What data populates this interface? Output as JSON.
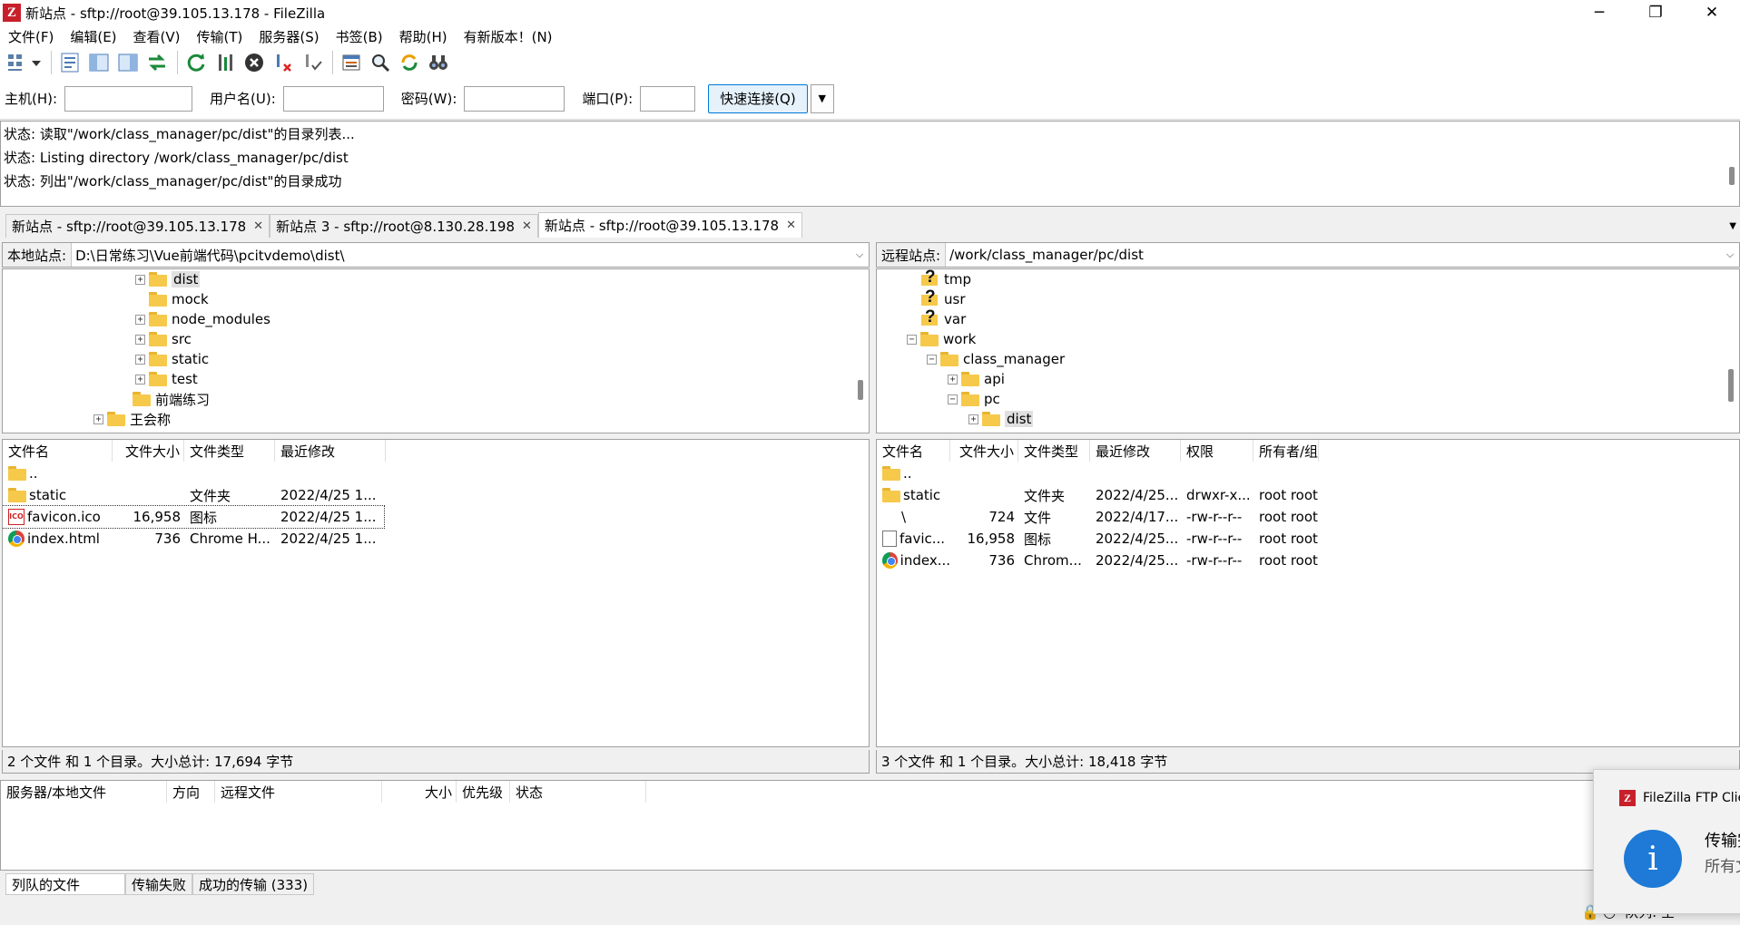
{
  "window": {
    "title": "新站点 - sftp://root@39.105.13.178 - FileZilla",
    "controls": [
      "─",
      "❐",
      "✕"
    ]
  },
  "menu": [
    "文件(F)",
    "编辑(E)",
    "查看(V)",
    "传输(T)",
    "服务器(S)",
    "书签(B)",
    "帮助(H)",
    "有新版本！(N)"
  ],
  "quickconnect": {
    "host_label": "主机(H):",
    "user_label": "用户名(U):",
    "pass_label": "密码(W):",
    "port_label": "端口(P):",
    "host_value": "",
    "user_value": "",
    "pass_value": "",
    "port_value": "",
    "connect_label": "快速连接(Q)"
  },
  "log": [
    "状态:  读取\"/work/class_manager/pc/dist\"的目录列表...",
    "状态:  Listing directory /work/class_manager/pc/dist",
    "状态:  列出\"/work/class_manager/pc/dist\"的目录成功"
  ],
  "tabs": [
    {
      "label": "新站点 - sftp://root@39.105.13.178"
    },
    {
      "label": "新站点 3 - sftp://root@8.130.28.198"
    },
    {
      "label": "新站点 - sftp://root@39.105.13.178"
    }
  ],
  "local": {
    "site_label": "本地站点:",
    "path": "D:\\日常练习\\Vue前端代码\\pcitvdemo\\dist\\",
    "tree": [
      {
        "name": "dist",
        "expander": "+"
      },
      {
        "name": "mock",
        "expander": ""
      },
      {
        "name": "node_modules",
        "expander": "+"
      },
      {
        "name": "src",
        "expander": "+"
      },
      {
        "name": "static",
        "expander": "+"
      },
      {
        "name": "test",
        "expander": "+"
      },
      {
        "name": "前端练习",
        "expander": ""
      },
      {
        "name": "王会称",
        "expander": "+"
      }
    ],
    "columns": [
      "文件名",
      "文件大小",
      "文件类型",
      "最近修改"
    ],
    "files": [
      {
        "name": "..",
        "size": "",
        "type": "",
        "modified": ""
      },
      {
        "name": "static",
        "size": "",
        "type": "文件夹",
        "modified": "2022/4/25 1..."
      },
      {
        "name": "favicon.ico",
        "size": "16,958",
        "type": "图标",
        "modified": "2022/4/25 1..."
      },
      {
        "name": "index.html",
        "size": "736",
        "type": "Chrome H...",
        "modified": "2022/4/25 1..."
      }
    ],
    "status": "2 个文件 和 1 个目录。大小总计: 17,694 字节"
  },
  "remote": {
    "site_label": "远程站点:",
    "path": "/work/class_manager/pc/dist",
    "tree": [
      {
        "name": "tmp",
        "expander": "",
        "icon": "unknown"
      },
      {
        "name": "usr",
        "expander": "",
        "icon": "unknown"
      },
      {
        "name": "var",
        "expander": "",
        "icon": "unknown"
      },
      {
        "name": "work",
        "expander": "−",
        "icon": "folder"
      },
      {
        "name": "class_manager",
        "expander": "−",
        "icon": "folder"
      },
      {
        "name": "api",
        "expander": "+",
        "icon": "folder"
      },
      {
        "name": "pc",
        "expander": "−",
        "icon": "folder"
      },
      {
        "name": "dist",
        "expander": "+",
        "icon": "folder"
      }
    ],
    "columns": [
      "文件名",
      "文件大小",
      "文件类型",
      "最近修改",
      "权限",
      "所有者/组"
    ],
    "files": [
      {
        "name": "..",
        "size": "",
        "type": "",
        "modified": "",
        "perms": "",
        "owner": ""
      },
      {
        "name": "static",
        "size": "",
        "type": "文件夹",
        "modified": "2022/4/25...",
        "perms": "drwxr-x...",
        "owner": "root root"
      },
      {
        "name": "\\",
        "size": "724",
        "type": "文件",
        "modified": "2022/4/17...",
        "perms": "-rw-r--r--",
        "owner": "root root"
      },
      {
        "name": "favic...",
        "size": "16,958",
        "type": "图标",
        "modified": "2022/4/25...",
        "perms": "-rw-r--r--",
        "owner": "root root"
      },
      {
        "name": "index...",
        "size": "736",
        "type": "Chrom...",
        "modified": "2022/4/25...",
        "perms": "-rw-r--r--",
        "owner": "root root"
      }
    ],
    "status": "3 个文件 和 1 个目录。大小总计: 18,418 字节"
  },
  "queue": {
    "columns": [
      "服务器/本地文件",
      "方向",
      "远程文件",
      "大小",
      "优先级",
      "状态"
    ],
    "tabs": [
      "列队的文件",
      "传输失败",
      "成功的传输 (333)"
    ]
  },
  "statusbar": {
    "queue": "队列: 空"
  },
  "toast": {
    "app": "FileZilla FTP Client",
    "title": "传输完成",
    "body": "所有文件均已成功传输"
  }
}
